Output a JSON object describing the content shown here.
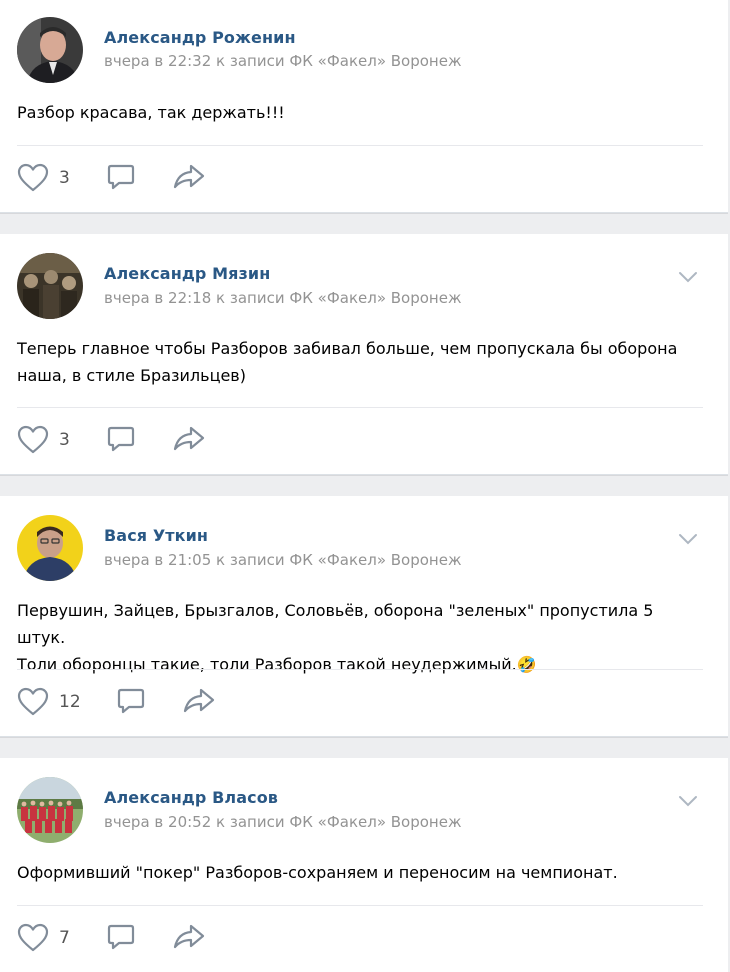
{
  "comments": [
    {
      "author": "Александр Роженин",
      "meta": "вчера в 22:32 к записи ФК «Факел» Воронеж",
      "text": [
        "Разбор красава, так держать!!!"
      ],
      "likes": "3",
      "avatar_icon": "man-in-suit-photo"
    },
    {
      "author": "Александр Мязин",
      "meta": "вчера в 22:18 к записи ФК «Факел» Воронеж",
      "text": [
        "Теперь главное чтобы Разборов забивал больше, чем пропускала бы оборона",
        "наша, в стиле Бразильцев)"
      ],
      "likes": "3",
      "avatar_icon": "sepia-group-photo"
    },
    {
      "author": "Вася Уткин",
      "meta": "вчера в 21:05 к записи ФК «Факел» Воронеж",
      "text": [
        "Первушин, Зайцев, Брызгалов, Соловьёв, оборона \"зеленых\" пропустила 5 штук.",
        "Толи оборонцы такие, толи Разборов такой неудержимый."
      ],
      "emoji": "🤣",
      "likes": "12",
      "avatar_icon": "man-on-yellow-photo"
    },
    {
      "author": "Александр Власов",
      "meta": "вчера в 20:52 к записи ФК «Факел» Воронеж",
      "text": [
        "Оформивший \"покер\" Разборов-сохраняем и переносим на чемпионат."
      ],
      "likes": "7",
      "avatar_icon": "football-team-photo"
    }
  ],
  "colors": {
    "author": "#2a5885",
    "meta": "#939393",
    "icon": "#818c99",
    "background": "#edeef0"
  }
}
